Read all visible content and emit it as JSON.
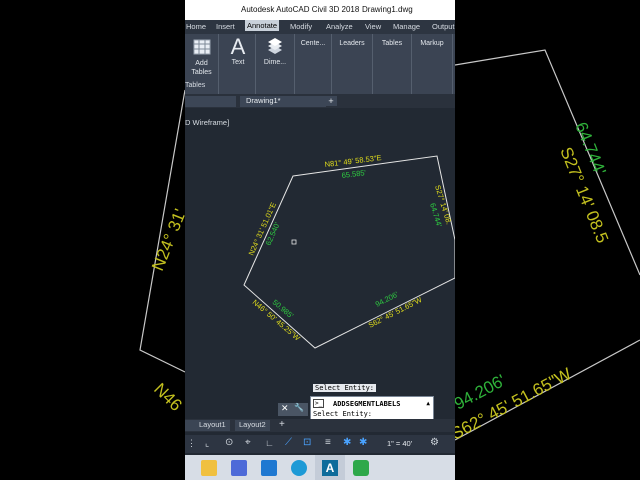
{
  "window": {
    "app_title": "Autodesk AutoCAD Civil 3D 2018",
    "file_title": "Drawing1.dwg"
  },
  "ribbon_tabs": [
    "Home",
    "Insert",
    "Annotate",
    "Modify",
    "Analyze",
    "View",
    "Manage",
    "Output"
  ],
  "ribbon_active": "Annotate",
  "ribbon_buttons": {
    "add_tables": "Add\nTables",
    "text": "Text",
    "dimension": "Dime...",
    "centerlines": "Cente...",
    "leaders": "Leaders",
    "tables": "Tables",
    "markup": "Markup",
    "tables_panel": "Tables"
  },
  "doc_tab": "Drawing1*",
  "viewport_label": "D Wireframe]",
  "labels": {
    "top_bearing": "N81° 49' 58.53\"E",
    "top_distance": "65.585'",
    "right_bearing": "S27° 14' 08.",
    "right_distance": "64.744'",
    "left_bearing": "N24° 31' 51.01\"E",
    "left_distance": "62.540'",
    "bottom_right_bearing": "S62° 45' 51.65\"W",
    "bottom_right_distance": "94.206'",
    "bottom_left_bearing": "N46° 50' 45.25\"W",
    "bottom_left_distance": "50.985'"
  },
  "bg_labels": {
    "right_bearing": "S27° 14' 08.5",
    "right_distance": "64.744'",
    "left_bearing": "N24° 31'",
    "bottom_bearing": "S62° 45' 51.65\"W",
    "bottom_distance": "94.206'",
    "bottom_left": "N46"
  },
  "command": {
    "header": "Select Entity:",
    "command_name": "ADDSEGMENTLABELS",
    "prompt": "Select Entity:"
  },
  "layout_tabs": [
    "Layout1",
    "Layout2"
  ],
  "status": {
    "scale": "1\" = 40'"
  },
  "colors": {
    "bearing_yellow": "#e3df1b",
    "distance_green": "#2ecc40",
    "viewport_bg": "#222933",
    "active_tab_bg": "#c9d1da"
  },
  "taskbar_icons": [
    "file-explorer-icon",
    "store-icon",
    "mail-icon",
    "edge-icon",
    "autocad-icon",
    "greenshot-icon"
  ]
}
